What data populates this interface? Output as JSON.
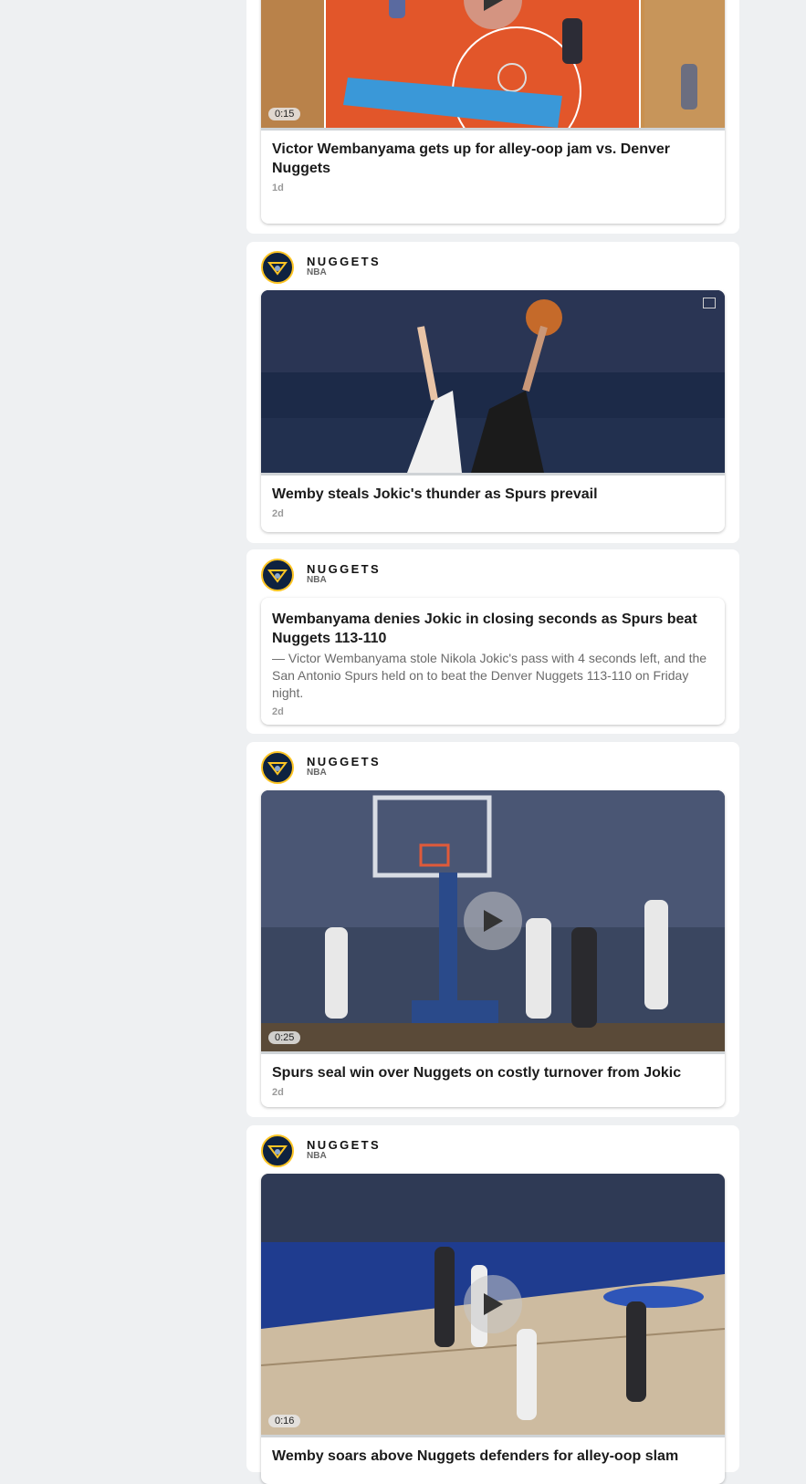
{
  "posts": [
    {
      "headline": "Victor Wembanyama gets up for alley-oop jam vs. Denver Nuggets",
      "age": "1d",
      "duration": "0:15"
    },
    {
      "team": "NUGGETS",
      "league": "NBA",
      "headline": "Wemby steals Jokic's thunder as Spurs prevail",
      "age": "2d"
    },
    {
      "team": "NUGGETS",
      "league": "NBA",
      "headline": "Wembanyama denies Jokic in closing seconds as Spurs beat Nuggets 113-110",
      "summary": "— Victor Wembanyama stole Nikola Jokic's pass with 4 seconds left, and the San Antonio Spurs held on to beat the Denver Nuggets 113-110 on Friday night.",
      "age": "2d"
    },
    {
      "team": "NUGGETS",
      "league": "NBA",
      "headline": "Spurs seal win over Nuggets on costly turnover from Jokic",
      "age": "2d",
      "duration": "0:25"
    },
    {
      "team": "NUGGETS",
      "league": "NBA",
      "headline": "Wemby soars above Nuggets defenders for alley-oop slam",
      "duration": "0:16"
    }
  ],
  "colors": {
    "page_bg": "#eef0f2",
    "nuggets_navy": "#0e2240",
    "nuggets_gold": "#fec524"
  },
  "icons": [
    "team-logo-icon",
    "play-icon",
    "image-icon"
  ]
}
